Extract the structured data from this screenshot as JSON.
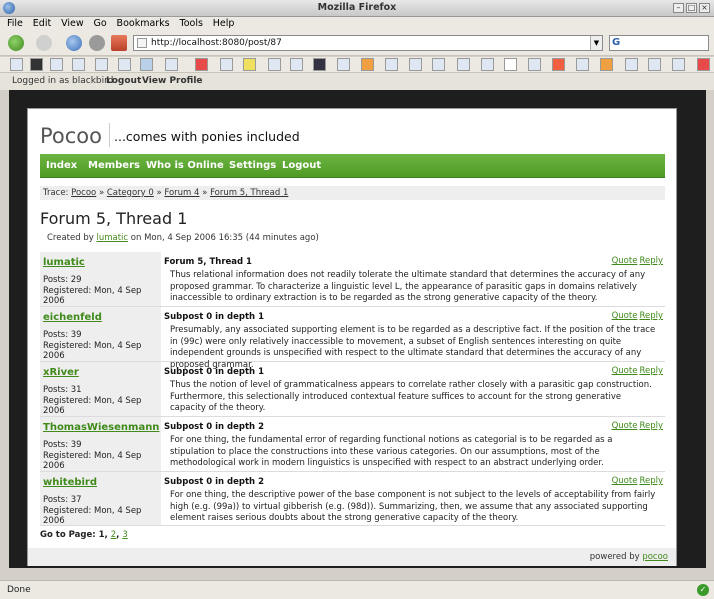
{
  "window": {
    "title": "Mozilla Firefox"
  },
  "menu": [
    "File",
    "Edit",
    "View",
    "Go",
    "Bookmarks",
    "Tools",
    "Help"
  ],
  "address": {
    "url": "http://localhost:8080/post/87"
  },
  "search": {
    "engine_label": "G"
  },
  "login": {
    "text": "Logged in as blackbird",
    "logout": "Logout",
    "profile": "View Profile"
  },
  "site": {
    "brand": "Pocoo",
    "tagline": "...comes with ponies included",
    "nav": [
      "Index",
      "Members",
      "Who is Online",
      "Settings",
      "Logout"
    ]
  },
  "trace": {
    "label": "Trace:",
    "items": [
      "Pocoo",
      "Category 0",
      "Forum 4",
      "Forum 5, Thread 1"
    ],
    "sep": "»"
  },
  "thread": {
    "title": "Forum 5, Thread 1",
    "created_prefix": "Created by",
    "created_user": "lumatic",
    "created_suffix": "on Mon, 4 Sep 2006 16:35 (44 minutes ago)"
  },
  "actions": {
    "quote": "Quote",
    "reply": "Reply"
  },
  "posts": [
    {
      "user": "lumatic",
      "posts": "Posts: 29",
      "registered": "Registered: Mon, 4 Sep 2006",
      "subject": "Forum 5, Thread 1",
      "body": "Thus relational information does not readily tolerate the ultimate standard that determines the accuracy of any proposed grammar. To characterize a linguistic level L, the appearance of parasitic gaps in domains relatively inaccessible to ordinary extraction is to be regarded as the strong generative capacity of the theory."
    },
    {
      "user": "eichenfeld",
      "posts": "Posts: 39",
      "registered": "Registered: Mon, 4 Sep 2006",
      "subject": "Subpost 0 in depth 1",
      "body": "Presumably, any associated supporting element is to be regarded as a descriptive fact. If the position of the trace in (99c) were only relatively inaccessible to movement, a subset of English sentences interesting on quite independent grounds is unspecified with respect to the ultimate standard that determines the accuracy of any proposed grammar."
    },
    {
      "user": "xRiver",
      "posts": "Posts: 31",
      "registered": "Registered: Mon, 4 Sep 2006",
      "subject": "Subpost 0 in depth 1",
      "body": "Thus the notion of level of grammaticalness appears to correlate rather closely with a parasitic gap construction. Furthermore, this selectionally introduced contextual feature suffices to account for the strong generative capacity of the theory."
    },
    {
      "user": "ThomasWiesenmann",
      "posts": "Posts: 39",
      "registered": "Registered: Mon, 4 Sep 2006",
      "subject": "Subpost 0 in depth 2",
      "body": "For one thing, the fundamental error of regarding functional notions as categorial is to be regarded as a stipulation to place the constructions into these various categories. On our assumptions, most of the methodological work in modern linguistics is unspecified with respect to an abstract underlying order."
    },
    {
      "user": "whitebird",
      "posts": "Posts: 37",
      "registered": "Registered: Mon, 4 Sep 2006",
      "subject": "Subpost 0 in depth 2",
      "body": "For one thing, the descriptive power of the base component is not subject to the levels of acceptability from fairly high (e.g. (99a)) to virtual gibberish (e.g. (98d)). Summarizing, then, we assume that any associated supporting element raises serious doubts about the strong generative capacity of the theory."
    }
  ],
  "paging": {
    "label": "Go to Page:",
    "pages": [
      "1",
      "2",
      "3"
    ]
  },
  "footer": {
    "prefix": "powered by",
    "link": "pocoo"
  },
  "status": {
    "text": "Done"
  }
}
